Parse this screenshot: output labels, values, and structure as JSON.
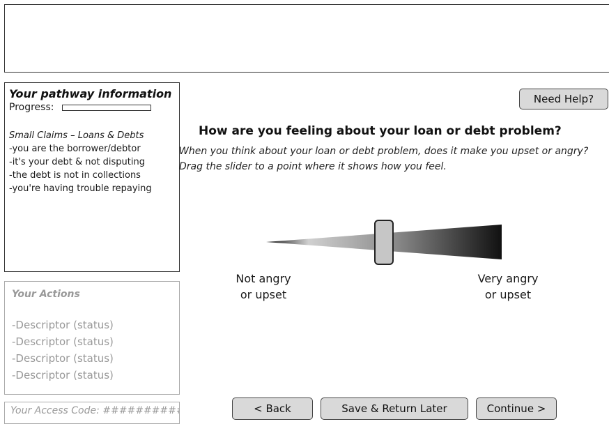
{
  "pathway": {
    "title": "Your pathway information",
    "progress_label": "Progress:",
    "progress_value": 0,
    "case_type": "Small Claims – Loans & Debts",
    "criteria": [
      "-you are the borrower/debtor",
      "-it's your debt & not disputing",
      "-the debt is not in collections",
      "-you're having trouble repaying"
    ]
  },
  "actions": {
    "title": "Your Actions",
    "items": [
      "-Descriptor (status)",
      "-Descriptor (status)",
      "-Descriptor (status)",
      "-Descriptor (status)"
    ]
  },
  "access_code": "Your Access Code: ##########",
  "help_button": "Need Help?",
  "question": "How are you feeling about your loan or debt problem?",
  "instructions": "When you think about your loan or debt problem, does it make you upset or angry? Drag the slider to a point where it shows how you feel.",
  "slider": {
    "min_label": "Not angry or upset",
    "min_label_lines": [
      "Not angry",
      "or upset"
    ],
    "max_label": "Very angry or upset",
    "max_label_lines": [
      "Very angry",
      "or upset"
    ],
    "value_fraction": 0.5
  },
  "nav": {
    "back": "< Back",
    "save": "Save & Return Later",
    "continue": "Continue >"
  },
  "colors": {
    "button_bg": "#d9d9d9",
    "slider_dark": "#111111",
    "slider_light": "#bdbdbd"
  }
}
